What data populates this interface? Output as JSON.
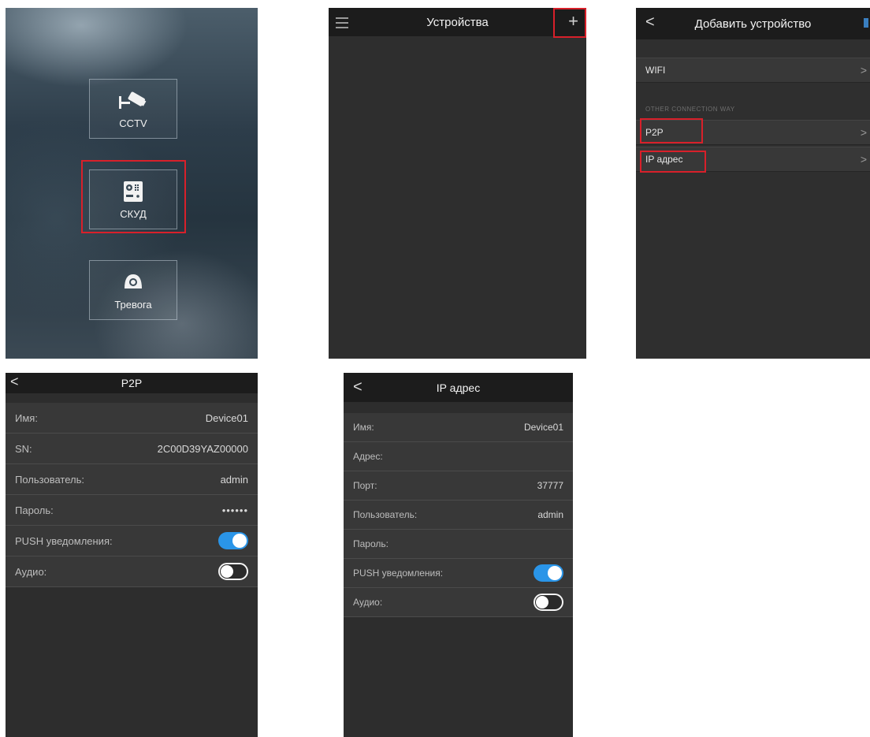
{
  "menu_screen": {
    "tiles": [
      {
        "label": "CCTV",
        "icon": "cctv-camera-icon"
      },
      {
        "label": "СКУД",
        "icon": "intercom-panel-icon"
      },
      {
        "label": "Тревога",
        "icon": "alarm-siren-icon"
      }
    ]
  },
  "devices_screen": {
    "title": "Устройства",
    "add_label": "+",
    "menu_icon": "hamburger-icon"
  },
  "add_device_screen": {
    "title": "Добавить устройство",
    "back_label": "<",
    "wifi_label": "WIFI",
    "section_label": "OTHER CONNECTION WAY",
    "p2p_label": "P2P",
    "ip_label": "IP адрес",
    "chevron": ">"
  },
  "p2p_screen": {
    "title": "P2P",
    "back_label": "<",
    "rows": {
      "name": {
        "label": "Имя:",
        "value": "Device01"
      },
      "sn": {
        "label": "SN:",
        "value": "2C00D39YAZ00000"
      },
      "user": {
        "label": "Пользователь:",
        "value": "admin"
      },
      "password": {
        "label": "Пароль:",
        "value": "••••••"
      },
      "push": {
        "label": "PUSH уведомления:",
        "on": true
      },
      "audio": {
        "label": "Аудио:",
        "on": false
      }
    }
  },
  "ip_screen": {
    "title": "IP адрес",
    "back_label": "<",
    "rows": {
      "name": {
        "label": "Имя:",
        "value": "Device01"
      },
      "address": {
        "label": "Адрес:",
        "value": ""
      },
      "port": {
        "label": "Порт:",
        "value": "37777"
      },
      "user": {
        "label": "Пользователь:",
        "value": "admin"
      },
      "password": {
        "label": "Пароль:",
        "value": ""
      },
      "push": {
        "label": "PUSH уведомления:",
        "on": true
      },
      "audio": {
        "label": "Аудио:",
        "on": false
      }
    }
  },
  "colors": {
    "highlight": "#d8202a",
    "toggle_on": "#2a95e8",
    "nav_bg": "#1c1c1c",
    "screen_bg": "#2d2d2d"
  }
}
